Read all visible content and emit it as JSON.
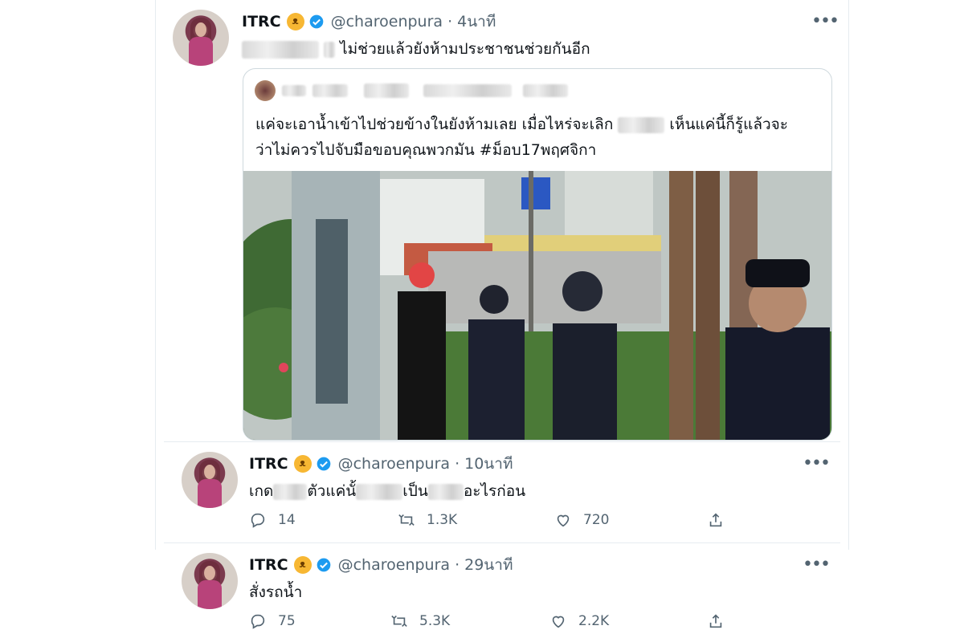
{
  "tweets": [
    {
      "name": "ITRC",
      "emoji": "😈",
      "handle": "@charoenpura",
      "time": "4นาที",
      "text": "ไม่ช่วยแล้วยังห้ามประชาชนช่วยกันอีก",
      "quote": {
        "line1_a": "แค่จะเอาน้ำเข้าไปช่วยข้างในยังห้ามเลย เมื่อไหร่จะเลิก",
        "line1_b": "เห็นแค่นี้ก็รู้แล้วจะ",
        "line2": "ว่าไม่ควรไปจับมือขอบคุณพวกมัน #ม็อบ17พฤศจิกา"
      }
    },
    {
      "name": "ITRC",
      "emoji": "😈",
      "handle": "@charoenpura",
      "time": "10นาที",
      "text_a": "เกด",
      "text_b": "ตัวแค่นั้",
      "text_c": "เป็น",
      "text_d": "อะไรก่อน",
      "replies": "14",
      "retweets": "1.3K",
      "likes": "720"
    },
    {
      "name": "ITRC",
      "emoji": "😈",
      "handle": "@charoenpura",
      "time": "29นาที",
      "text": "สั่งรถน้ำ",
      "replies": "75",
      "retweets": "5.3K",
      "likes": "2.2K"
    }
  ],
  "icons": {
    "more": "more-icon",
    "reply": "reply-icon",
    "retweet": "retweet-icon",
    "like": "like-icon",
    "share": "share-icon",
    "verified": "verified-badge-icon"
  },
  "colors": {
    "text": "#0f1419",
    "secondary": "#536471",
    "border": "#cfd9de",
    "verified": "#1d9bf0",
    "emoji": "#f7b733"
  }
}
